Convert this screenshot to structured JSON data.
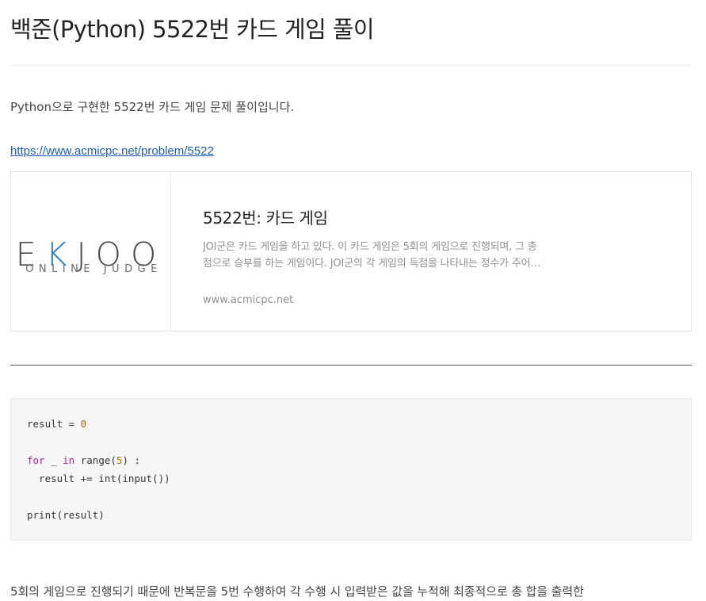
{
  "post": {
    "title": "백준(Python) 5522번 카드 게임 풀이",
    "intro": "Python으로 구현한 5522번 카드 게임 문제 풀이입니다.",
    "link_text": "https://www.acmicpc.net/problem/5522"
  },
  "link_card": {
    "logo_main_left": "E",
    "logo_main_accent": "K",
    "logo_main_right": "JOO",
    "logo_sub": "ONLINE JUDGE",
    "title": "5522번: 카드 게임",
    "desc_line1": "JOI군은 카드 게임을 하고 있다. 이 카드 게임은 5회의 게임으로 진행되며, 그 총",
    "desc_line2": "점으로 승부를 하는 게임이다. JOI군의 각 게임의 득점을 나타내는 정수가 주어…",
    "domain": "www.acmicpc.net"
  },
  "code": {
    "l1_a": "result = ",
    "l1_num": "0",
    "l3_kw1": "for",
    "l3_mid": " _ ",
    "l3_kw2": "in",
    "l3_b": " range(",
    "l3_num": "5",
    "l3_c": ") :",
    "l4": "  result += int(input())",
    "l6": "print(result)"
  },
  "body": {
    "paragraph": "5회의 게임으로 진행되기 때문에 반복문을 5번 수행하여 각 수행 시 입력받은 값을 누적해 최종적으로 총 합을 출력한"
  },
  "colors": {
    "link": "#1a5fb4",
    "logo_accent": "#2b7fc1",
    "code_keyword": "#a626a4",
    "code_number": "#b76b01",
    "code_background": "#f6f6f6"
  }
}
